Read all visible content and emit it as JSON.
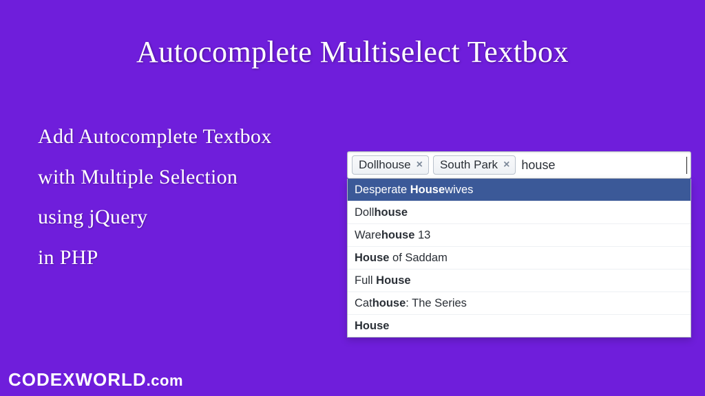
{
  "title": "Autocomplete Multiselect Textbox",
  "subtitle_lines": [
    "Add Autocomplete Textbox",
    "with Multiple Selection",
    "using jQuery",
    "in PHP"
  ],
  "tokens": [
    {
      "label": "Dollhouse"
    },
    {
      "label": "South Park"
    }
  ],
  "typed": "house",
  "dropdown": [
    {
      "pre": "Desperate ",
      "match": "House",
      "post": "wives",
      "active": true
    },
    {
      "pre": "Doll",
      "match": "house",
      "post": "",
      "active": false
    },
    {
      "pre": "Ware",
      "match": "house",
      "post": " 13",
      "active": false
    },
    {
      "pre": "",
      "match": "House",
      "post": " of Saddam",
      "active": false
    },
    {
      "pre": "Full ",
      "match": "House",
      "post": "",
      "active": false
    },
    {
      "pre": "Cat",
      "match": "house",
      "post": ": The Series",
      "active": false
    },
    {
      "pre": "",
      "match": "House",
      "post": "",
      "active": false
    }
  ],
  "watermark": {
    "brand": "CODEXWORLD",
    "suffix": ".com"
  }
}
